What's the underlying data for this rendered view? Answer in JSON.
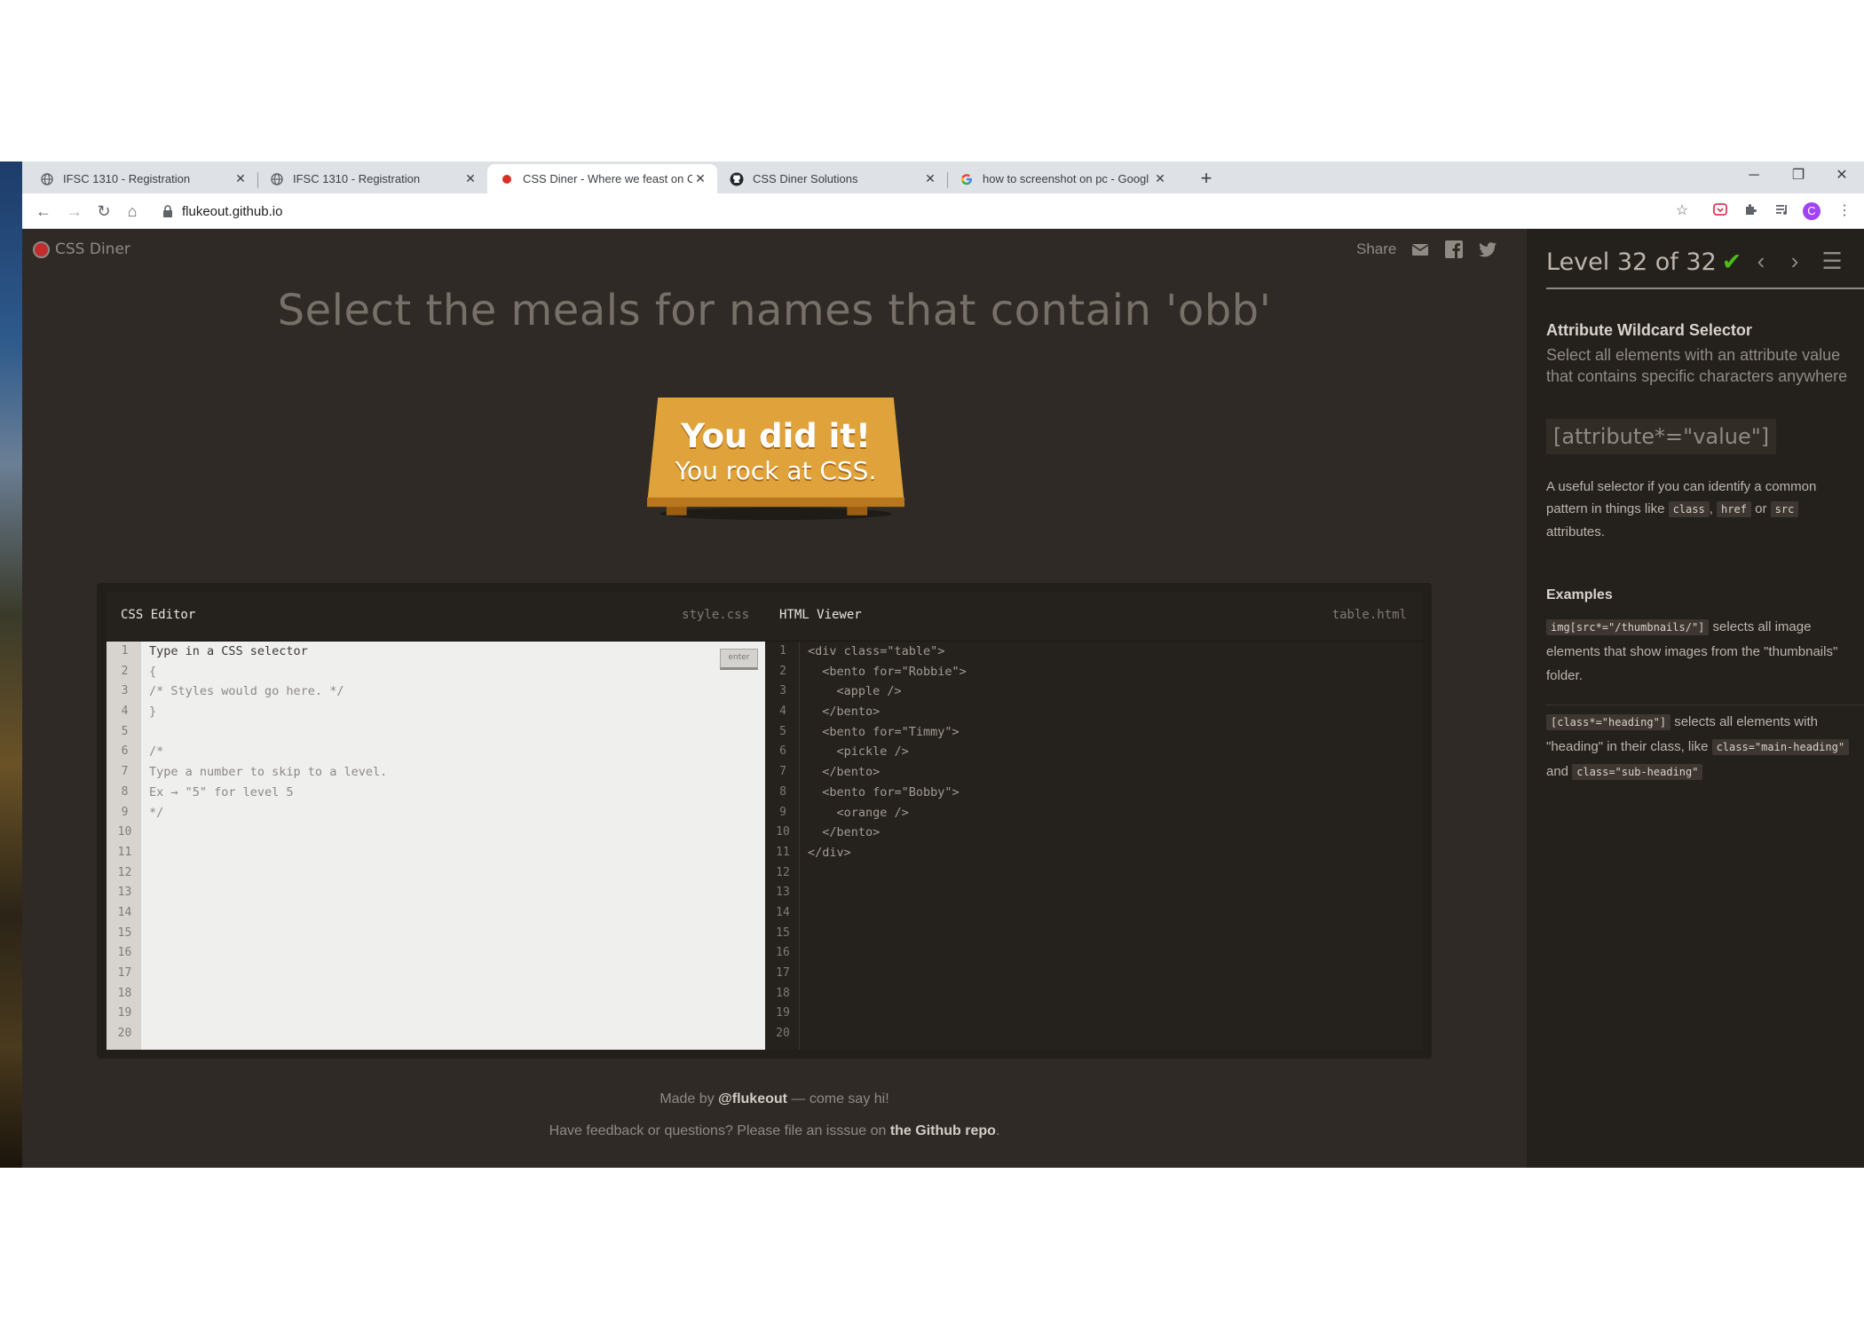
{
  "browser": {
    "tabs": [
      {
        "title": "IFSC 1310 - Registration",
        "icon": "globe-icon",
        "active": false
      },
      {
        "title": "IFSC 1310 - Registration",
        "icon": "globe-icon",
        "active": false
      },
      {
        "title": "CSS Diner - Where we feast on C",
        "icon": "css-diner-icon",
        "active": true
      },
      {
        "title": "CSS Diner Solutions",
        "icon": "github-icon",
        "active": false
      },
      {
        "title": "how to screenshot on pc - Googl",
        "icon": "google-icon",
        "active": false
      }
    ],
    "url": "flukeout.github.io",
    "avatar_letter": "C"
  },
  "app": {
    "logo_text": "CSS Diner",
    "share_label": "Share",
    "instruction": "Select the meals for names that contain 'obb'",
    "plate_line1": "You did it!",
    "plate_line2": "You rock at CSS.",
    "plate_color": "#e0a23a"
  },
  "css_editor": {
    "title": "CSS Editor",
    "file": "style.css",
    "enter_label": "enter",
    "lines": [
      "Type in a CSS selector",
      "{",
      "/* Styles would go here. */",
      "}",
      "",
      "/*",
      "Type a number to skip to a level.",
      "Ex → \"5\" for level 5",
      "*/",
      "",
      "",
      "",
      "",
      "",
      "",
      "",
      "",
      "",
      "",
      ""
    ],
    "line_numbers": [
      "1",
      "2",
      "3",
      "4",
      "5",
      "6",
      "7",
      "8",
      "9",
      "10",
      "11",
      "12",
      "13",
      "14",
      "15",
      "16",
      "17",
      "18",
      "19",
      "20"
    ]
  },
  "html_viewer": {
    "title": "HTML Viewer",
    "file": "table.html",
    "lines": [
      "<div class=\"table\">",
      "  <bento for=\"Robbie\">",
      "    <apple />",
      "  </bento>",
      "  <bento for=\"Timmy\">",
      "    <pickle />",
      "  </bento>",
      "  <bento for=\"Bobby\">",
      "    <orange />",
      "  </bento>",
      "</div>",
      "",
      "",
      "",
      "",
      "",
      "",
      "",
      "",
      ""
    ],
    "line_numbers": [
      "1",
      "2",
      "3",
      "4",
      "5",
      "6",
      "7",
      "8",
      "9",
      "10",
      "11",
      "12",
      "13",
      "14",
      "15",
      "16",
      "17",
      "18",
      "19",
      "20"
    ]
  },
  "footer": {
    "made_by_prefix": "Made by ",
    "made_by_handle": "@flukeout",
    "made_by_suffix": " — come say hi!",
    "feedback_prefix": "Have feedback or questions? Please file an isssue on ",
    "feedback_link": "the Github repo",
    "feedback_suffix": "."
  },
  "sidebar": {
    "level_text": "Level 32 of 32",
    "progress": 1.0,
    "selector_name": "Attribute Wildcard Selector",
    "selector_title": "Select all elements with an attribute value that contains specific characters anywhere",
    "syntax": "[attribute*=\"value\"]",
    "hint_part1": "A useful selector if you can identify a common pattern in things like ",
    "hint_tag1": "class",
    "hint_part2": ", ",
    "hint_tag2": "href",
    "hint_part3": " or ",
    "hint_tag3": "src",
    "hint_part4": " attributes.",
    "examples_title": "Examples",
    "example1_code": "img[src*=\"/thumbnails/\"]",
    "example1_text": " selects all image elements that show images from the \"thumbnails\" folder.",
    "example2_code": "[class*=\"heading\"]",
    "example2_text1": " selects all elements with \"heading\" in their class, like ",
    "example2_code2": "class=\"main-heading\"",
    "example2_text2": " and ",
    "example2_code3": "class=\"sub-heading\""
  }
}
